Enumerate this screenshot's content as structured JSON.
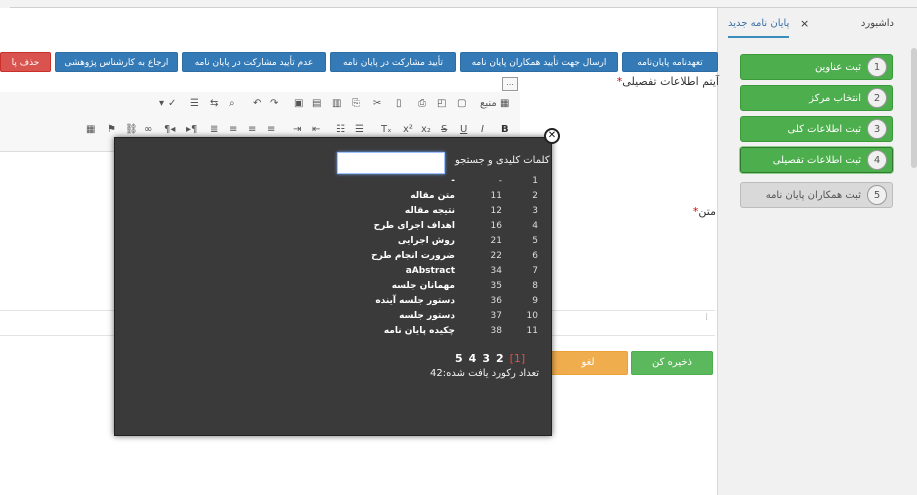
{
  "tabs": [
    {
      "label": "داشبورد"
    },
    {
      "label": "پایان نامه جدید",
      "close": "×"
    }
  ],
  "steps": [
    {
      "num": "1",
      "label": "ثبت عناوین",
      "state": "done"
    },
    {
      "num": "2",
      "label": "انتخاب مرکز",
      "state": "done"
    },
    {
      "num": "3",
      "label": "ثبت اطلاعات کلی",
      "state": "done"
    },
    {
      "num": "4",
      "label": "ثبت اطلاعات تفصیلی",
      "state": "current"
    },
    {
      "num": "5",
      "label": "ثبت همکاران پایان نامه",
      "state": "disabled"
    }
  ],
  "toolbar": {
    "buttons": [
      "تعهدنامه پایان‌نامه",
      "ارسال جهت تأیید همکاران پایان نامه",
      "تأیید مشارکت در پایان نامه",
      "عدم تأیید مشارکت در پایان نامه",
      "ارجاع به کارشناس پژوهشی",
      "حذف پا"
    ]
  },
  "form": {
    "item_label": "آیتم اطلاعات تفصیلی",
    "required_mark": "*",
    "text_label": "متن",
    "save_label": "ذخیره کن",
    "cancel_label": "لغو",
    "small_box": "..."
  },
  "editor": {
    "source_label": "منبع",
    "row2_end": "B"
  },
  "modal": {
    "close_glyph": "✕",
    "search_label": "کلمات کلیدی و جستجو",
    "search_value": "",
    "rows": [
      {
        "idx": "1",
        "code": "-",
        "title": "-"
      },
      {
        "idx": "2",
        "code": "11",
        "title": "متن مقاله"
      },
      {
        "idx": "3",
        "code": "12",
        "title": "نتیجه مقاله"
      },
      {
        "idx": "4",
        "code": "16",
        "title": "اهداف اجرای طرح"
      },
      {
        "idx": "5",
        "code": "21",
        "title": "روش اجرایی"
      },
      {
        "idx": "6",
        "code": "22",
        "title": "ضرورت انجام طرح"
      },
      {
        "idx": "7",
        "code": "34",
        "title": "aAbstract"
      },
      {
        "idx": "8",
        "code": "35",
        "title": "مهمانان جلسه"
      },
      {
        "idx": "9",
        "code": "36",
        "title": "دستور جلسه آینده"
      },
      {
        "idx": "10",
        "code": "37",
        "title": "دستور جلسه"
      },
      {
        "idx": "11",
        "code": "38",
        "title": "چکیده پایان نامه"
      }
    ],
    "pager": {
      "current": "[1]",
      "pages": [
        "2",
        "3",
        "4",
        "5"
      ]
    },
    "count_text": "تعداد رکورد یافت شده:42"
  },
  "colors": {
    "primary": "#337ab7",
    "success": "#5cb85c",
    "warning": "#f0ad4e",
    "danger": "#d9534f",
    "modal_bg": "#3a3a3a"
  }
}
